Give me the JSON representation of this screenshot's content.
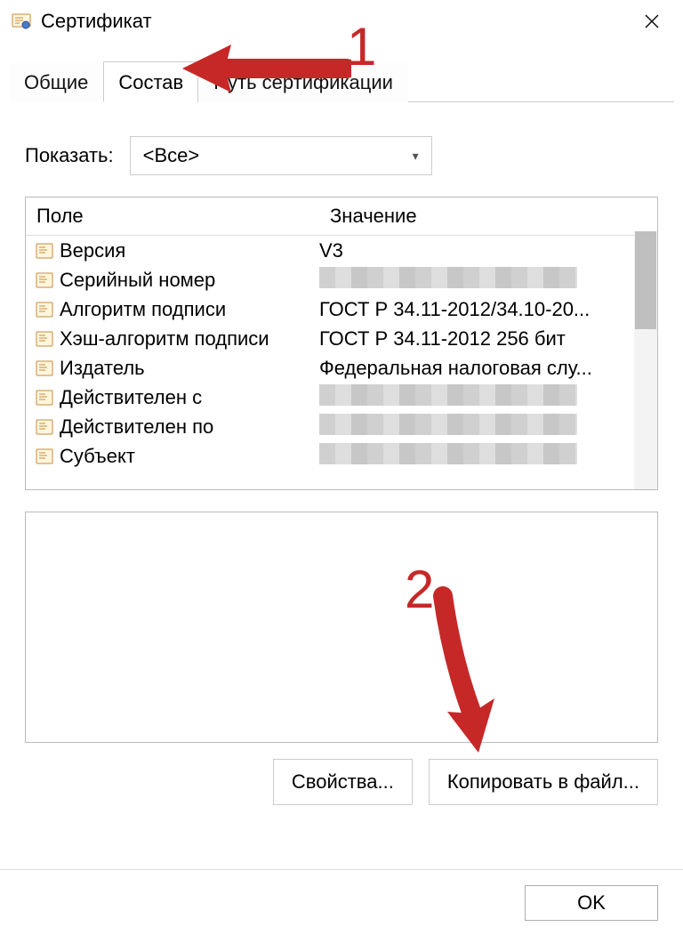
{
  "window": {
    "title": "Сертификат"
  },
  "tabs": [
    "Общие",
    "Состав",
    "Путь сертификации"
  ],
  "active_tab_index": 1,
  "filter": {
    "label": "Показать:",
    "selected": "<Все>"
  },
  "columns": [
    "Поле",
    "Значение"
  ],
  "fields": [
    {
      "name": "Версия",
      "value": "V3",
      "blurred": false
    },
    {
      "name": "Серийный номер",
      "value": "",
      "blurred": true
    },
    {
      "name": "Алгоритм подписи",
      "value": "ГОСТ Р 34.11-2012/34.10-20...",
      "blurred": false
    },
    {
      "name": "Хэш-алгоритм подписи",
      "value": "ГОСТ Р 34.11-2012 256 бит",
      "blurred": false
    },
    {
      "name": "Издатель",
      "value": "Федеральная налоговая слу...",
      "blurred": false
    },
    {
      "name": "Действителен с",
      "value": "",
      "blurred": true
    },
    {
      "name": "Действителен по",
      "value": "",
      "blurred": true
    },
    {
      "name": "Субъект",
      "value": "",
      "blurred": true
    }
  ],
  "buttons": {
    "properties": "Свойства...",
    "copy_to_file": "Копировать в файл...",
    "ok": "OK"
  },
  "annotations": {
    "marker1": "1",
    "marker2": "2"
  },
  "colors": {
    "annotation": "#c62828",
    "thumb": "#bfbfbf",
    "icon_border": "#c78a3a",
    "icon_inner": "#f6d08a"
  }
}
